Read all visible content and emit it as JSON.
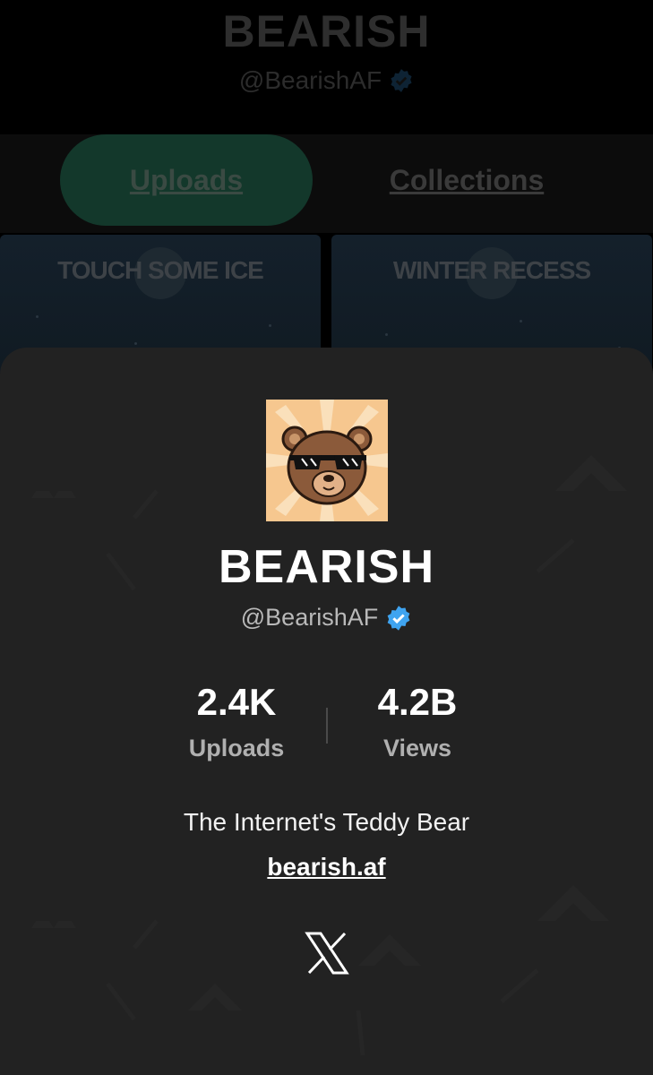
{
  "background": {
    "title": "BEARISH",
    "handle": "@BearishAF",
    "tabs": [
      "Uploads",
      "Collections"
    ],
    "cards": [
      "TOUCH SOME ICE",
      "WINTER RECESS"
    ]
  },
  "profile": {
    "avatar": "bear-with-sunglasses-avatar",
    "name": "BEARISH",
    "handle": "@BearishAF",
    "verified_icon": "verified-badge-icon",
    "stats": {
      "uploads_value": "2.4K",
      "uploads_label": "Uploads",
      "views_value": "4.2B",
      "views_label": "Views"
    },
    "bio": "The Internet's Teddy Bear",
    "link": "bearish.af",
    "social_icon": "x-logo-icon"
  },
  "colors": {
    "sheet_bg": "#222222",
    "verified_blue": "#3fa4f0",
    "active_tab": "#13382b",
    "avatar_bg": "#f6c78f",
    "bear_brown": "#8b5a3a"
  }
}
